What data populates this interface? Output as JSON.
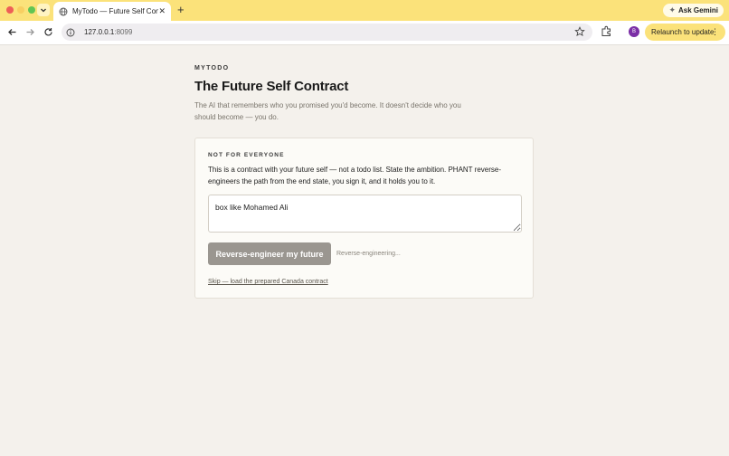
{
  "browser": {
    "tab_title": "MyTodo — Future Self Contract",
    "url_host": "127.0.0.1",
    "url_port": ":8099",
    "ask_gemini_label": "Ask Gemini",
    "profile_initial": "B",
    "relaunch_label": "Relaunch to update",
    "accent_color": "#fbe27a"
  },
  "page": {
    "brand": "MYTODO",
    "title": "The Future Self Contract",
    "subtitle": "The AI that remembers who you promised you'd become. It doesn't decide who you should become — you do."
  },
  "card": {
    "kicker": "NOT FOR EVERYONE",
    "description": "This is a contract with your future self — not a todo list. State the ambition. PHANT reverse-engineers the path from the end state, you sign it, and it holds you to it.",
    "ambition_value": "box like Mohamed Ali",
    "submit_label": "Reverse-engineer my future",
    "status": "Reverse-engineering...",
    "skip_link": "Skip — load the prepared Canada contract"
  }
}
